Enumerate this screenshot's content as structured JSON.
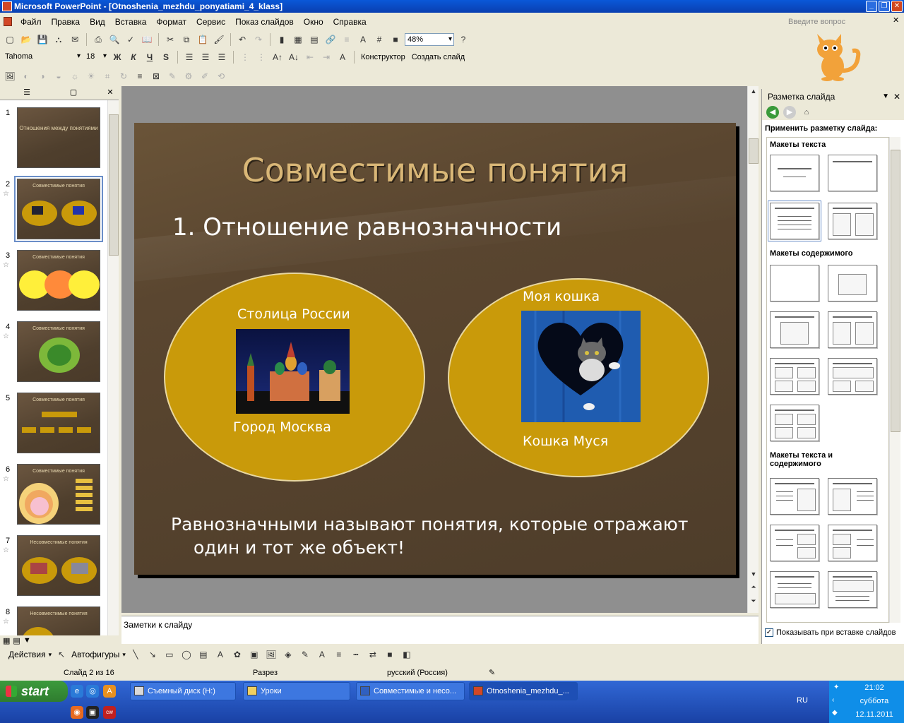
{
  "window": {
    "title": "Microsoft PowerPoint - [Otnoshenia_mezhdu_ponyatiami_4_klass]"
  },
  "menu": [
    "Файл",
    "Правка",
    "Вид",
    "Вставка",
    "Формат",
    "Сервис",
    "Показ слайдов",
    "Окно",
    "Справка"
  ],
  "help_placeholder": "Введите вопрос",
  "toolbar": {
    "zoom": "48%",
    "font": "Tahoma",
    "size": "18",
    "bold": "Ж",
    "italic": "К",
    "underline": "Ч",
    "shadow": "S",
    "designer": "Конструктор",
    "new_slide": "Создать слайд"
  },
  "thumbs": [
    {
      "num": "1",
      "title": "Отношения между понятиями"
    },
    {
      "num": "2",
      "title": "Совместимые понятия"
    },
    {
      "num": "3",
      "title": "Совместимые понятия"
    },
    {
      "num": "4",
      "title": "Совместимые понятия"
    },
    {
      "num": "5",
      "title": "Совместимые понятия"
    },
    {
      "num": "6",
      "title": "Совместимые понятия"
    },
    {
      "num": "7",
      "title": "Несовместимые понятия"
    },
    {
      "num": "8",
      "title": "Несовместимые понятия"
    }
  ],
  "slide": {
    "title": "Совместимые понятия",
    "subtitle": "1. Отношение равнозначности",
    "left_top": "Столица России",
    "left_bottom": "Город Москва",
    "right_top": "Моя кошка",
    "right_bottom": "Кошка Муся",
    "bottom_line1": "Равнозначными называют понятия, которые отражают",
    "bottom_line2": "один и тот же объект!"
  },
  "notes_placeholder": "Заметки к слайду",
  "taskpane": {
    "title": "Разметка слайда",
    "apply_label": "Применить разметку слайда:",
    "sec_text": "Макеты текста",
    "sec_content": "Макеты содержимого",
    "sec_text_content": "Макеты текста и содержимого",
    "show_on_insert": "Показывать при вставке слайдов"
  },
  "drawing": {
    "actions": "Действия",
    "autoshapes": "Автофигуры"
  },
  "status": {
    "slide": "Слайд 2 из 16",
    "design": "Разрез",
    "lang": "русский (Россия)"
  },
  "taskbar": {
    "start": "start",
    "tasks": [
      "Съемный диск (H:)",
      "Уроки",
      "Совместимые и несо...",
      "Otnoshenia_mezhdu_..."
    ],
    "lang": "RU",
    "time": "21:02",
    "day": "суббота",
    "date": "12.11.2011"
  }
}
